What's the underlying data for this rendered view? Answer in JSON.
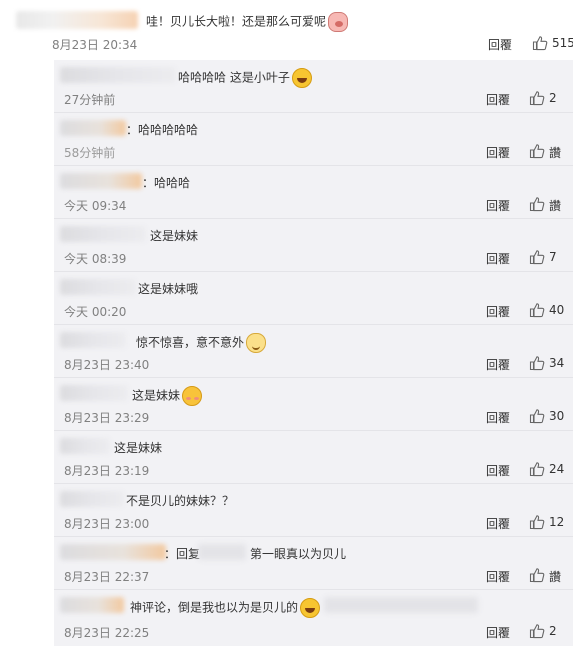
{
  "main_comment": {
    "text": "哇！贝儿长大啦！还是那么可爱呢",
    "emoji": "pig-face-icon",
    "date": "8月23日 20:34",
    "reply_label": "回覆",
    "like_count": "515"
  },
  "replies": [
    {
      "text": "哈哈哈哈 这是小叶子",
      "emoji": "laugh-cry-icon",
      "date": "27分钟前",
      "reply_label": "回覆",
      "like_count": "2"
    },
    {
      "text": "：哈哈哈哈哈",
      "emoji": "",
      "date": "58分钟前",
      "reply_label": "回覆",
      "like_count": "讚"
    },
    {
      "text": "：哈哈哈",
      "emoji": "",
      "date": "今天 09:34",
      "reply_label": "回覆",
      "like_count": "讚"
    },
    {
      "text": "这是妹妹",
      "emoji": "",
      "date": "今天 08:39",
      "reply_label": "回覆",
      "like_count": "7"
    },
    {
      "text": "这是妹妹哦",
      "emoji": "",
      "date": "今天 00:20",
      "reply_label": "回覆",
      "like_count": "40"
    },
    {
      "text": "惊不惊喜，意不意外",
      "emoji": "cat-face-icon",
      "date": "8月23日 23:40",
      "reply_label": "回覆",
      "like_count": "34"
    },
    {
      "text": "这是妹妹",
      "emoji": "blush-face-icon",
      "date": "8月23日 23:29",
      "reply_label": "回覆",
      "like_count": "30"
    },
    {
      "text": "这是妹妹",
      "emoji": "",
      "date": "8月23日 23:19",
      "reply_label": "回覆",
      "like_count": "24"
    },
    {
      "text": "不是贝儿的妹妹？？",
      "emoji": "",
      "date": "8月23日 23:00",
      "reply_label": "回覆",
      "like_count": "12"
    },
    {
      "text": "：回复",
      "text2": "第一眼真以为贝儿",
      "emoji": "",
      "date": "8月23日 22:37",
      "reply_label": "回覆",
      "like_count": "讚"
    },
    {
      "text": "神评论，倒是我也以为是贝儿的",
      "emoji": "laugh-cry-icon",
      "date": "8月23日 22:25",
      "reply_label": "回覆",
      "like_count": "2"
    }
  ]
}
